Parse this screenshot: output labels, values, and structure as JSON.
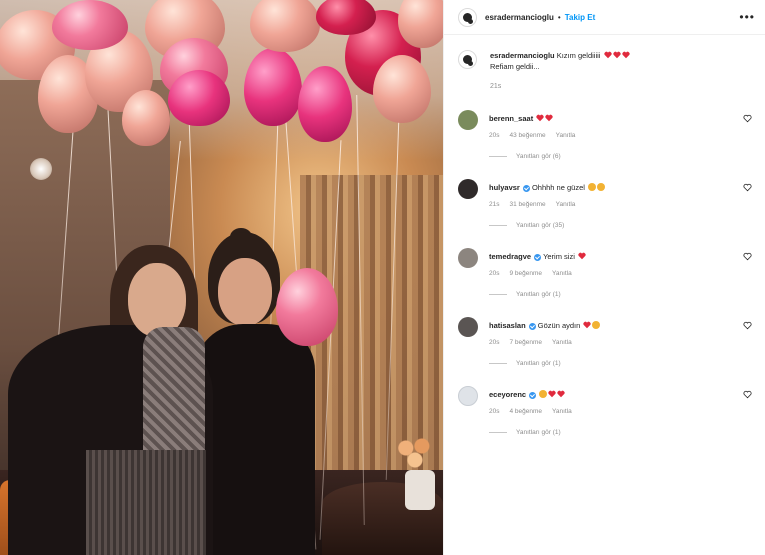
{
  "post": {
    "username": "esradermancioglu",
    "separator": "•",
    "follow_label": "Takip Et",
    "more_label": "•••",
    "caption_line1": "Kızım geldiiiii",
    "caption_line2": "Refiam geldii...",
    "caption_time": "21s"
  },
  "colors": {
    "accent": "#0095f6",
    "verified": "#3897f0",
    "heart": "#e02a3d",
    "muted": "#8e8e8e"
  },
  "comments": [
    {
      "username": "berenn_saat",
      "verified": false,
      "text": "",
      "emoji": [
        "heart-red-icon",
        "heart-red-icon"
      ],
      "time": "20s",
      "likes": "43 beğenme",
      "reply": "Yanıtla",
      "view_replies": "Yanıtları gör (6)",
      "avatar_color": "#7a8b5c"
    },
    {
      "username": "hulyavsr",
      "verified": true,
      "text": "Ohhhh ne güzel",
      "emoji": [
        "heart-eyes-icon",
        "heart-eyes-icon"
      ],
      "time": "21s",
      "likes": "31 beğenme",
      "reply": "Yanıtla",
      "view_replies": "Yanıtları gör (35)",
      "avatar_color": "#2f2a2a"
    },
    {
      "username": "temedragve",
      "verified": true,
      "text": "Yerim sizi",
      "emoji": [
        "heart-red-icon"
      ],
      "time": "20s",
      "likes": "9 beğenme",
      "reply": "Yanıtla",
      "view_replies": "Yanıtları gör (1)",
      "avatar_color": "#8c857f"
    },
    {
      "username": "hatisaslan",
      "verified": true,
      "text": "Gözün aydın",
      "emoji": [
        "heart-red-icon",
        "heart-eyes-icon"
      ],
      "time": "20s",
      "likes": "7 beğenme",
      "reply": "Yanıtla",
      "view_replies": "Yanıtları gör (1)",
      "avatar_color": "#5a5553"
    },
    {
      "username": "eceyorenc",
      "verified": true,
      "text": "",
      "emoji": [
        "heart-eyes-icon",
        "heart-red-icon",
        "heart-red-icon"
      ],
      "time": "20s",
      "likes": "4 beğenme",
      "reply": "Yanıtla",
      "view_replies": "Yanıtları gör (1)",
      "avatar_color": "#dfe3e8"
    }
  ]
}
